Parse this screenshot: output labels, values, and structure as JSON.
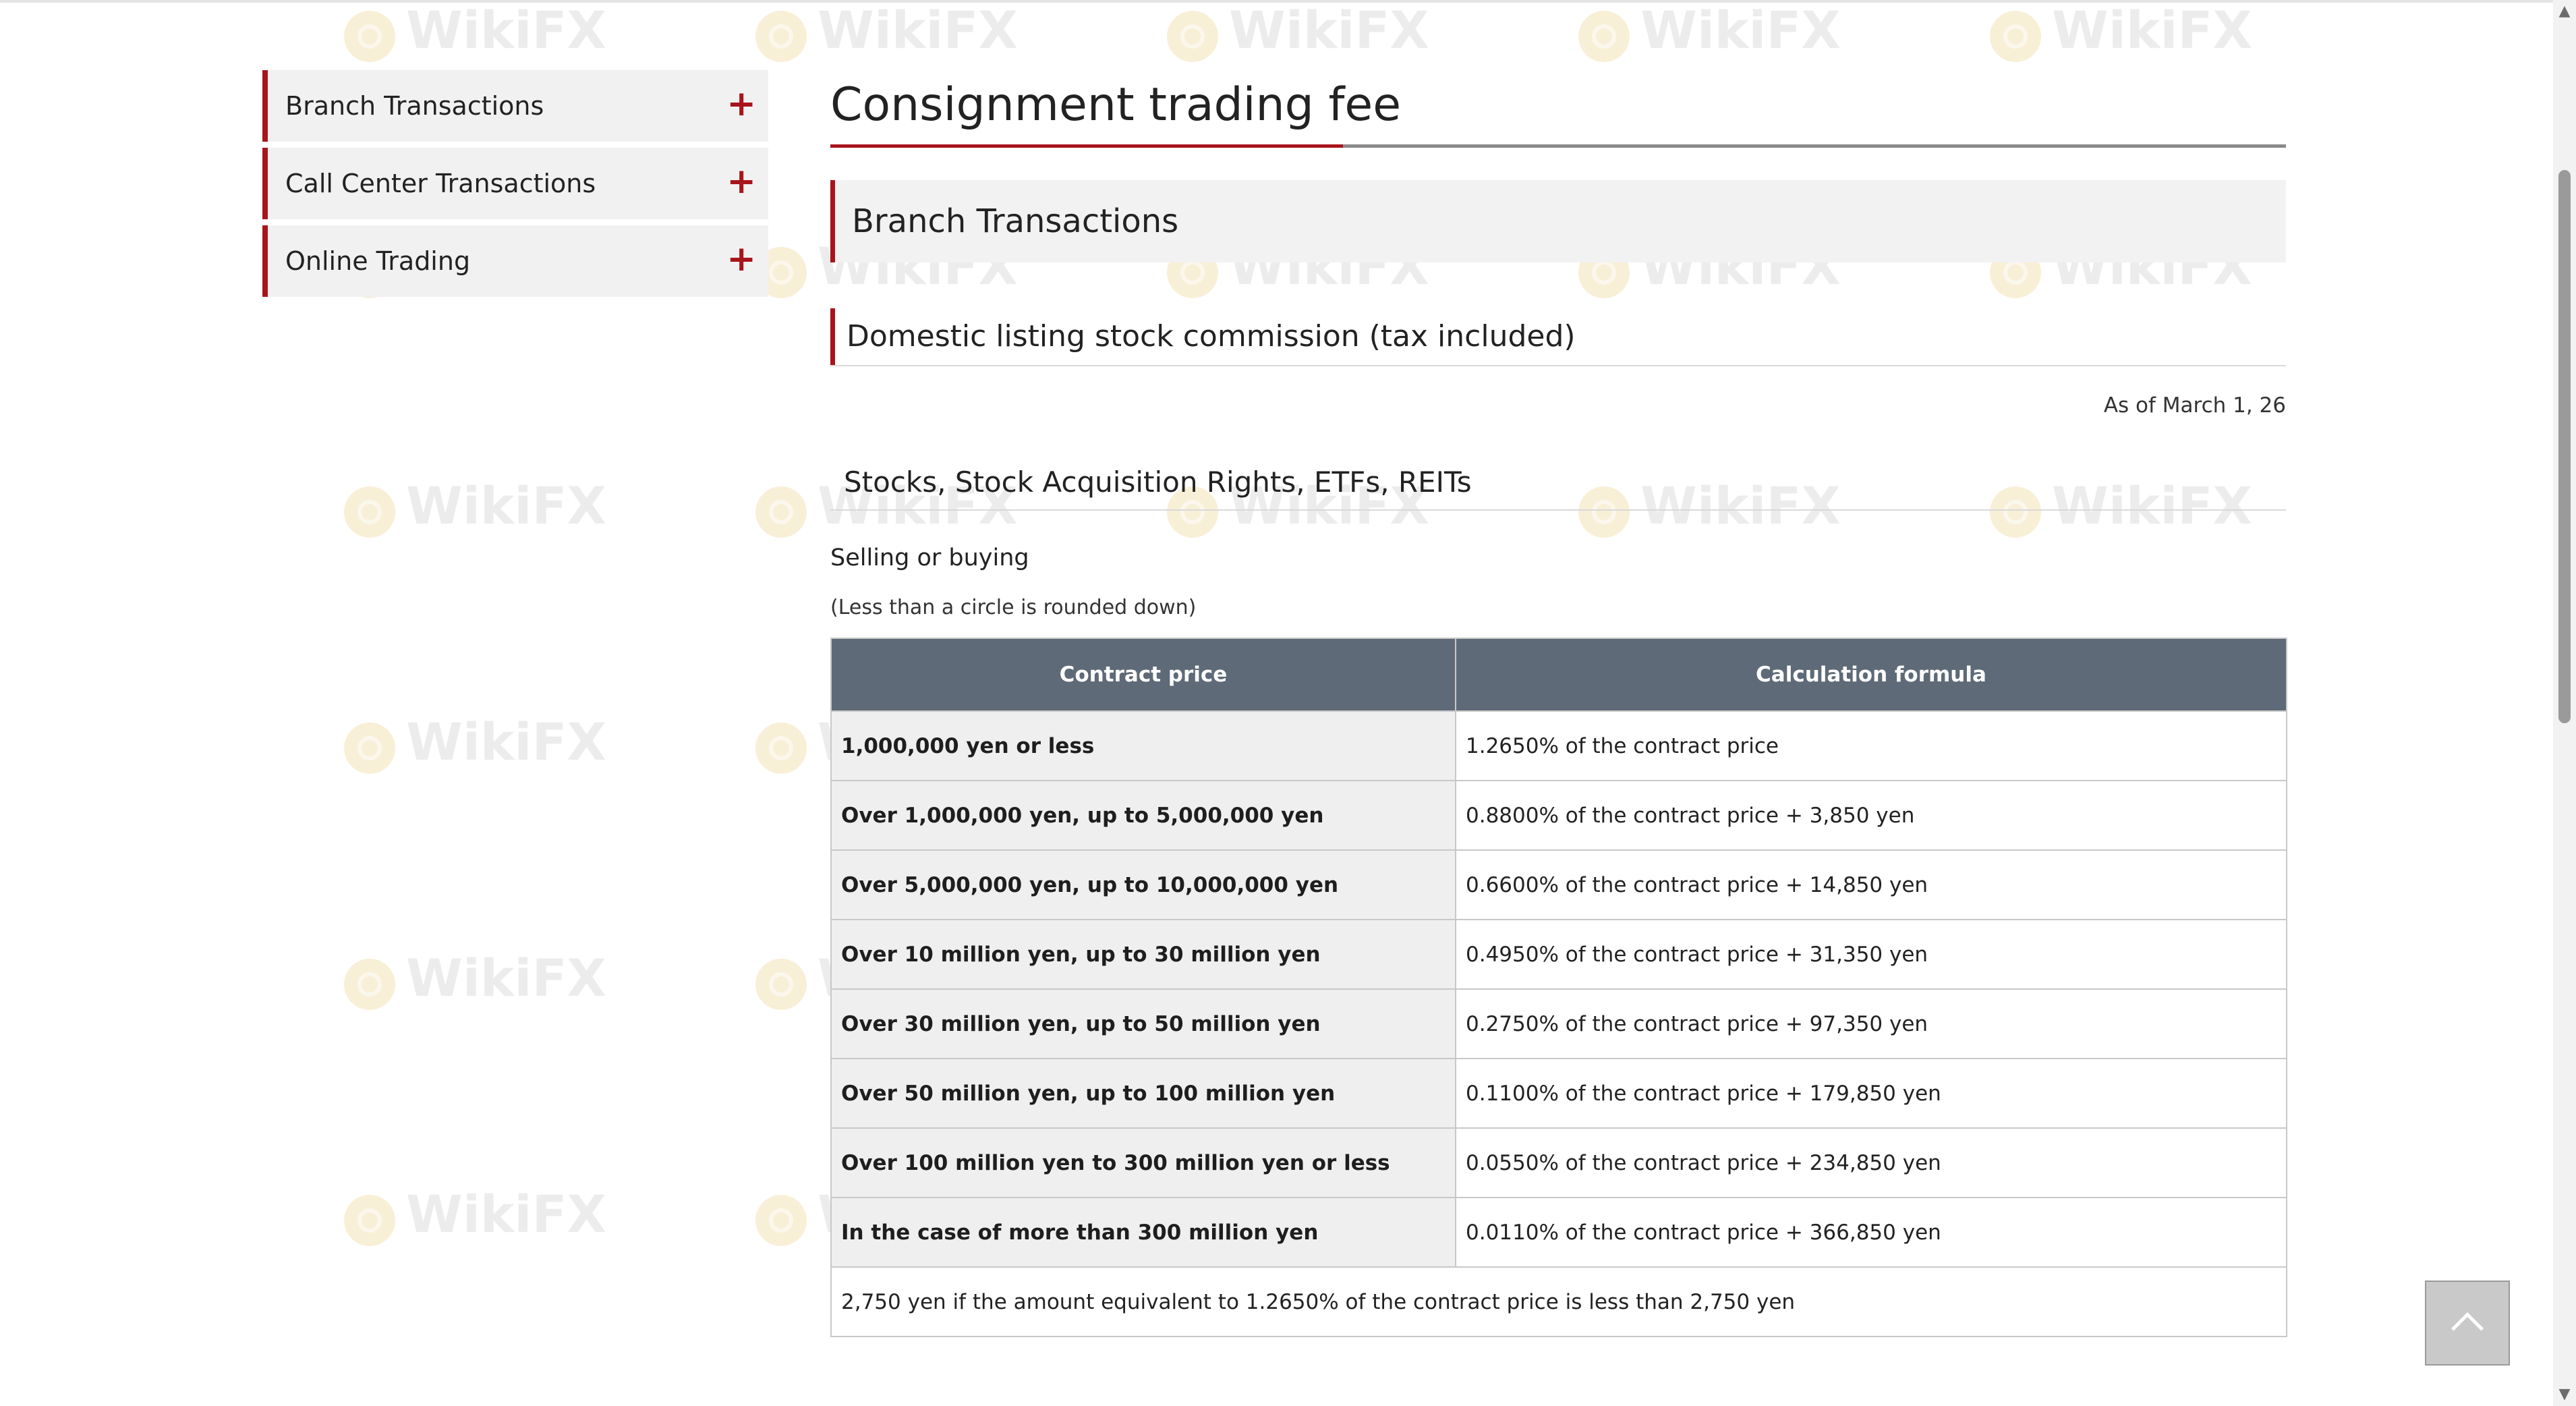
{
  "sidebar": {
    "items": [
      {
        "label": "Branch Transactions",
        "icon": "plus-icon"
      },
      {
        "label": "Call Center Transactions",
        "icon": "plus-icon"
      },
      {
        "label": "Online Trading",
        "icon": "plus-icon"
      }
    ]
  },
  "main": {
    "title": "Consignment trading fee",
    "section_heading": "Branch Transactions",
    "subsection_heading": "Domestic listing stock commission (tax included)",
    "as_of": "As of March 1, 26",
    "category_heading": "Stocks, Stock Acquisition Rights, ETFs, REITs",
    "trade_type": "Selling or buying",
    "rounding_note": "(Less than a circle is rounded down)"
  },
  "table": {
    "headers": [
      "Contract price",
      "Calculation formula"
    ],
    "rows": [
      {
        "price": "1,000,000 yen or less",
        "formula": "1.2650% of the contract price"
      },
      {
        "price": "Over 1,000,000 yen, up to 5,000,000 yen",
        "formula": "0.8800% of the contract price + 3,850 yen"
      },
      {
        "price": "Over 5,000,000 yen, up to 10,000,000 yen",
        "formula": "0.6600% of the contract price + 14,850 yen"
      },
      {
        "price": "Over 10 million yen, up to 30 million yen",
        "formula": "0.4950% of the contract price + 31,350 yen"
      },
      {
        "price": "Over 30 million yen, up to 50 million yen",
        "formula": "0.2750% of the contract price + 97,350 yen"
      },
      {
        "price": "Over 50 million yen, up to 100 million yen",
        "formula": "0.1100% of the contract price + 179,850 yen"
      },
      {
        "price": "Over 100 million yen to 300 million yen or less",
        "formula": "0.0550% of the contract price + 234,850 yen"
      },
      {
        "price": "In the case of more than 300 million yen",
        "formula": "0.0110% of the contract price + 366,850 yen"
      }
    ],
    "footer": "2,750 yen if the amount equivalent to 1.2650% of the contract price is less than 2,750 yen"
  },
  "watermark": {
    "text": "WikiFX"
  },
  "colors": {
    "accent": "#a8141c",
    "table_header_bg": "#5e6a77",
    "sidebar_bg": "#f1f1f1"
  },
  "icons": {
    "back_to_top": "chevron-up-icon",
    "scroll_up": "scroll-up-arrow-icon",
    "scroll_down": "scroll-down-arrow-icon"
  }
}
